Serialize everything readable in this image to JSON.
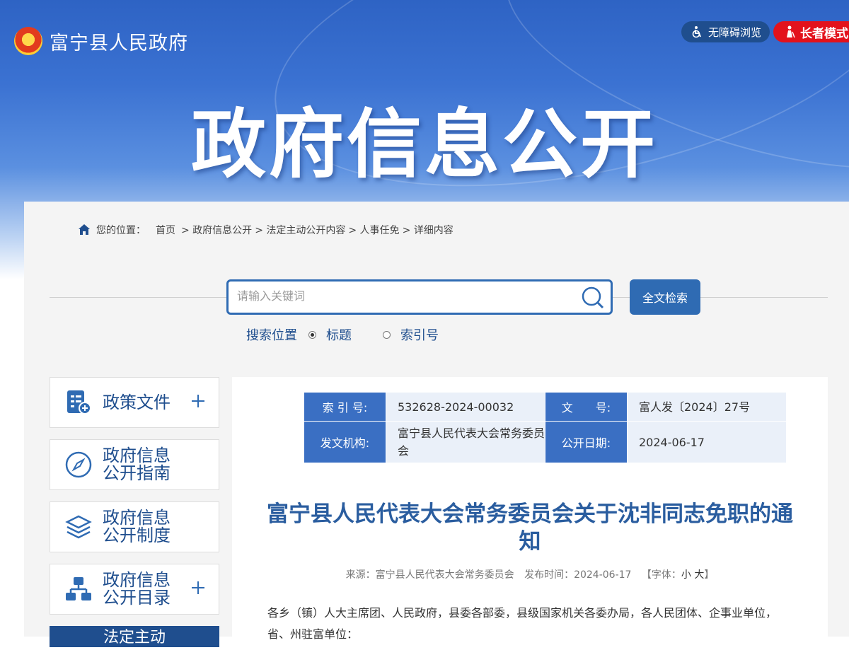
{
  "header": {
    "site_name": "富宁县人民政府",
    "accessibility_label": "无障碍浏览",
    "elder_mode_label": "长者模式",
    "hero_title": "政府信息公开"
  },
  "breadcrumb": {
    "prefix": "您的位置：",
    "items": [
      "首页",
      "> 政府信息公开",
      "> 法定主动公开内容",
      "> 人事任免",
      "> 详细内容"
    ]
  },
  "search": {
    "placeholder": "请输入关键词",
    "button_label": "全文检索",
    "scope_label": "搜索位置",
    "options": [
      "标题",
      "索引号"
    ],
    "selected": "标题"
  },
  "sidebar": {
    "items": [
      {
        "label": "政策文件",
        "icon": "policy-document-icon",
        "expandable": true
      },
      {
        "label": "政府信息公开指南",
        "line1": "政府信息",
        "line2": "公开指南",
        "icon": "compass-icon",
        "expandable": false
      },
      {
        "label": "政府信息公开制度",
        "line1": "政府信息",
        "line2": "公开制度",
        "icon": "layers-icon",
        "expandable": false
      },
      {
        "label": "政府信息公开目录",
        "line1": "政府信息",
        "line2": "公开目录",
        "icon": "org-chart-icon",
        "expandable": true
      }
    ],
    "active_label": "法定主动"
  },
  "meta": {
    "index_label": "索 引 号:",
    "index_value": "532628-2024-00032",
    "docno_label": "文　　号:",
    "docno_value": "富人发〔2024〕27号",
    "issuer_label": "发文机构:",
    "issuer_value": "富宁县人民代表大会常务委员会",
    "date_label": "公开日期:",
    "date_value": "2024-06-17"
  },
  "article": {
    "title": "富宁县人民代表大会常务委员会关于沈非同志免职的通知",
    "source_label": "来源：富宁县人民代表大会常务委员会",
    "publish_label": "发布时间：2024-06-17",
    "font_label": "【字体：",
    "font_small": "小",
    "font_large": "大",
    "font_close": "】",
    "body_line1": "各乡（镇）人大主席团、人民政府，县委各部委，县级国家机关各委办局，各人民团体、企事业单位，",
    "body_line2": "省、州驻富单位："
  },
  "colors": {
    "primary": "#2f6bb3",
    "dark_blue": "#1f4e8e",
    "elder_red": "#e3121c",
    "table_header": "#3a6fc3"
  }
}
